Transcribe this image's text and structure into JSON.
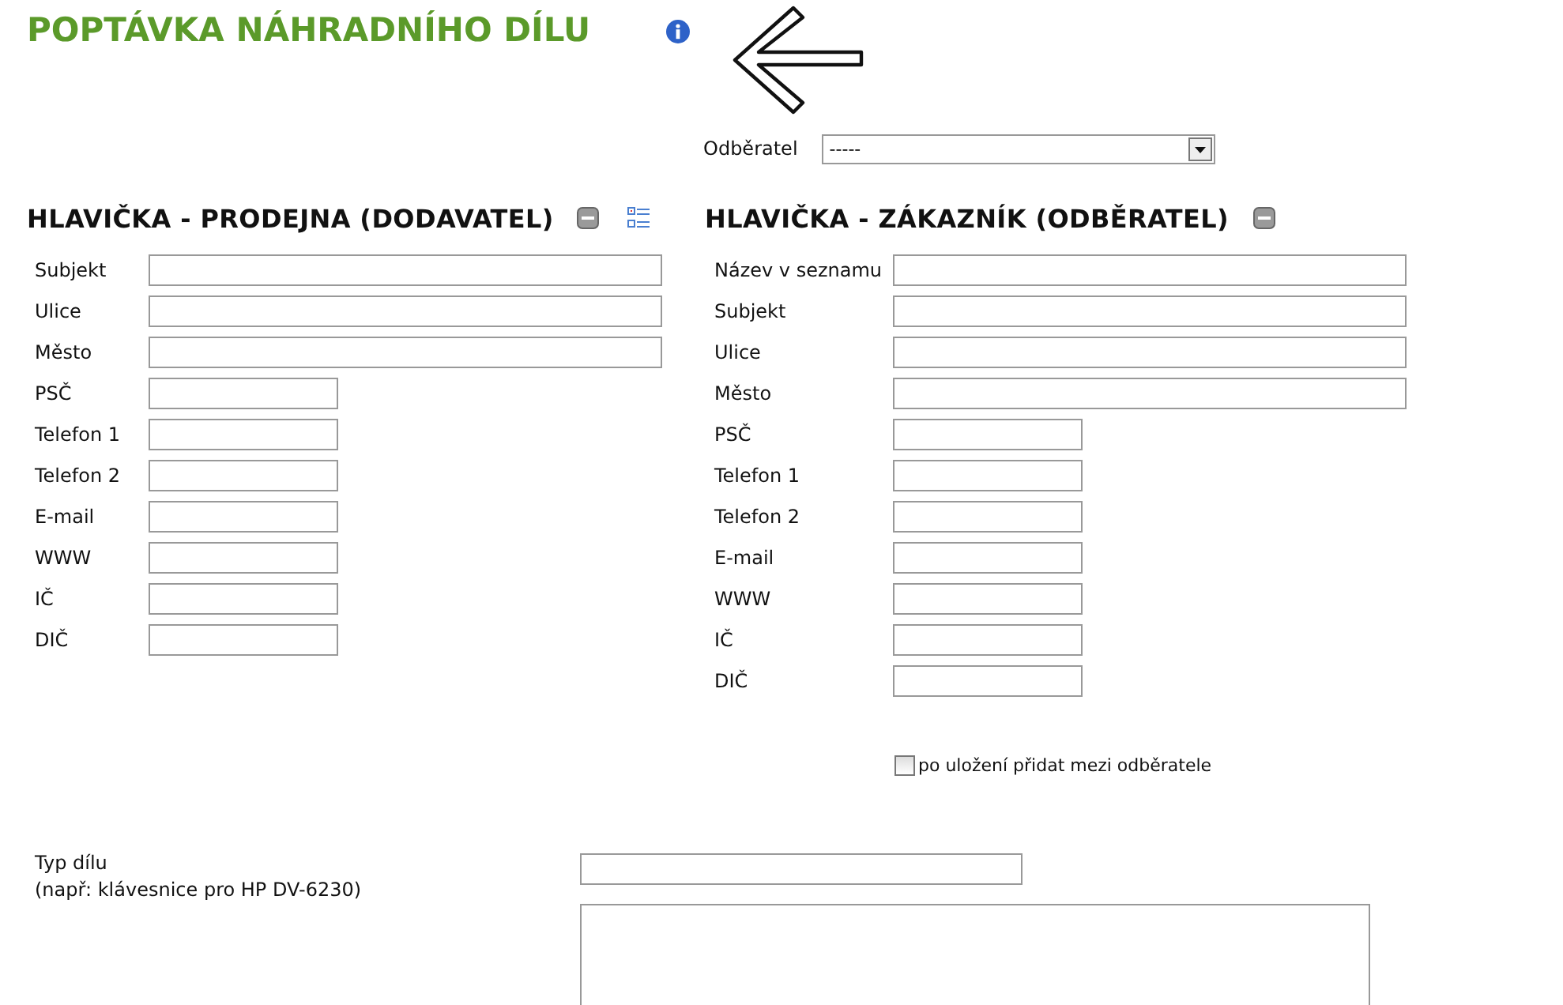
{
  "title": "POPTÁVKA NÁHRADNÍHO DÍLU",
  "customer_select": {
    "label": "Odběratel",
    "value": "-----"
  },
  "sections": [
    {
      "title": "HLAVIČKA - PRODEJNA (DODAVATEL)",
      "list_icon": true,
      "fields": [
        {
          "label": "Subjekt",
          "kind": "long"
        },
        {
          "label": "Ulice",
          "kind": "long"
        },
        {
          "label": "Město",
          "kind": "long"
        },
        {
          "label": "PSČ",
          "kind": "short"
        },
        {
          "label": "Telefon 1",
          "kind": "short"
        },
        {
          "label": "Telefon 2",
          "kind": "short"
        },
        {
          "label": "E-mail",
          "kind": "short"
        },
        {
          "label": "WWW",
          "kind": "short"
        },
        {
          "label": "IČ",
          "kind": "short"
        },
        {
          "label": "DIČ",
          "kind": "short"
        }
      ]
    },
    {
      "title": "HLAVIČKA - ZÁKAZNÍK (ODBĚRATEL)",
      "list_icon": false,
      "fields": [
        {
          "label": "Název v seznamu",
          "kind": "long"
        },
        {
          "label": "Subjekt",
          "kind": "long"
        },
        {
          "label": "Ulice",
          "kind": "long"
        },
        {
          "label": "Město",
          "kind": "long"
        },
        {
          "label": "PSČ",
          "kind": "short"
        },
        {
          "label": "Telefon 1",
          "kind": "short"
        },
        {
          "label": "Telefon 2",
          "kind": "short"
        },
        {
          "label": "E-mail",
          "kind": "short"
        },
        {
          "label": "WWW",
          "kind": "short"
        },
        {
          "label": "IČ",
          "kind": "short"
        },
        {
          "label": "DIČ",
          "kind": "short"
        }
      ]
    }
  ],
  "add_customer": {
    "label": "po uložení přidat mezi odběratele",
    "checked": false
  },
  "part_type": {
    "label": "Typ dílu",
    "hint": "(např: klávesnice pro HP DV-6230)"
  }
}
